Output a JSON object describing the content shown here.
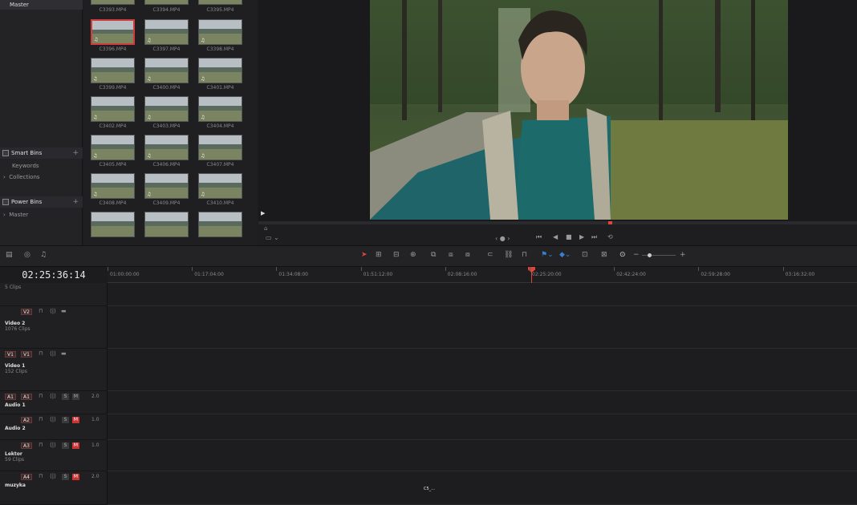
{
  "bins": {
    "master_label": "Master",
    "smart_bins": {
      "title": "Smart Bins",
      "items": [
        "Keywords",
        "Collections"
      ]
    },
    "power_bins": {
      "title": "Power Bins",
      "items": [
        "Master"
      ]
    }
  },
  "media_pool": {
    "top_labels": [
      "C3393.MP4",
      "C3394.MP4",
      "C3395.MP4"
    ],
    "clips": [
      "C3396.MP4",
      "C3397.MP4",
      "C3398.MP4",
      "C3399.MP4",
      "C3400.MP4",
      "C3401.MP4",
      "C3402.MP4",
      "C3403.MP4",
      "C3404.MP4",
      "C3405.MP4",
      "C3406.MP4",
      "C3407.MP4",
      "C3408.MP4",
      "C3409.MP4",
      "C3410.MP4"
    ],
    "selected_clip": "C3396.MP4"
  },
  "viewer": {
    "playback_controls": [
      "skip-start-icon",
      "play-reverse-icon",
      "stop-icon",
      "play-icon",
      "skip-end-icon",
      "loop-icon"
    ]
  },
  "timeline": {
    "timecode": "02:25:36:14",
    "ruler_labels": [
      "01:00:00:00",
      "01:17:04:00",
      "01:34:08:00",
      "01:51:12:00",
      "02:08:16:00",
      "02:25:20:00",
      "02:42:24:00",
      "02:59:28:00",
      "03:16:32:00"
    ],
    "playhead_fraction": 0.565,
    "tracks": [
      {
        "id": "",
        "name": "",
        "count": "5 Clips"
      },
      {
        "id": "V2",
        "name": "Video 2",
        "count": "1076 Clips"
      },
      {
        "id": "V1",
        "src": "V1",
        "name": "Video 1",
        "count": "152 Clips"
      },
      {
        "id": "A1",
        "src": "A1",
        "name": "Audio 1",
        "count": "",
        "vol": "2.0"
      },
      {
        "id": "A2",
        "name": "Audio 2",
        "count": "",
        "vol": "1.0"
      },
      {
        "id": "A3",
        "name": "Lektor",
        "count": "59 Clips",
        "vol": "1.0"
      },
      {
        "id": "A4",
        "name": "muzyka",
        "count": "",
        "vol": "2.0"
      }
    ],
    "music_clip_label": "C5_..."
  },
  "colors": {
    "video_clip": "#4a7fb3",
    "audio_clip": "#3a9a5c",
    "playhead": "#e0453c",
    "selection": "#d23c3c"
  }
}
